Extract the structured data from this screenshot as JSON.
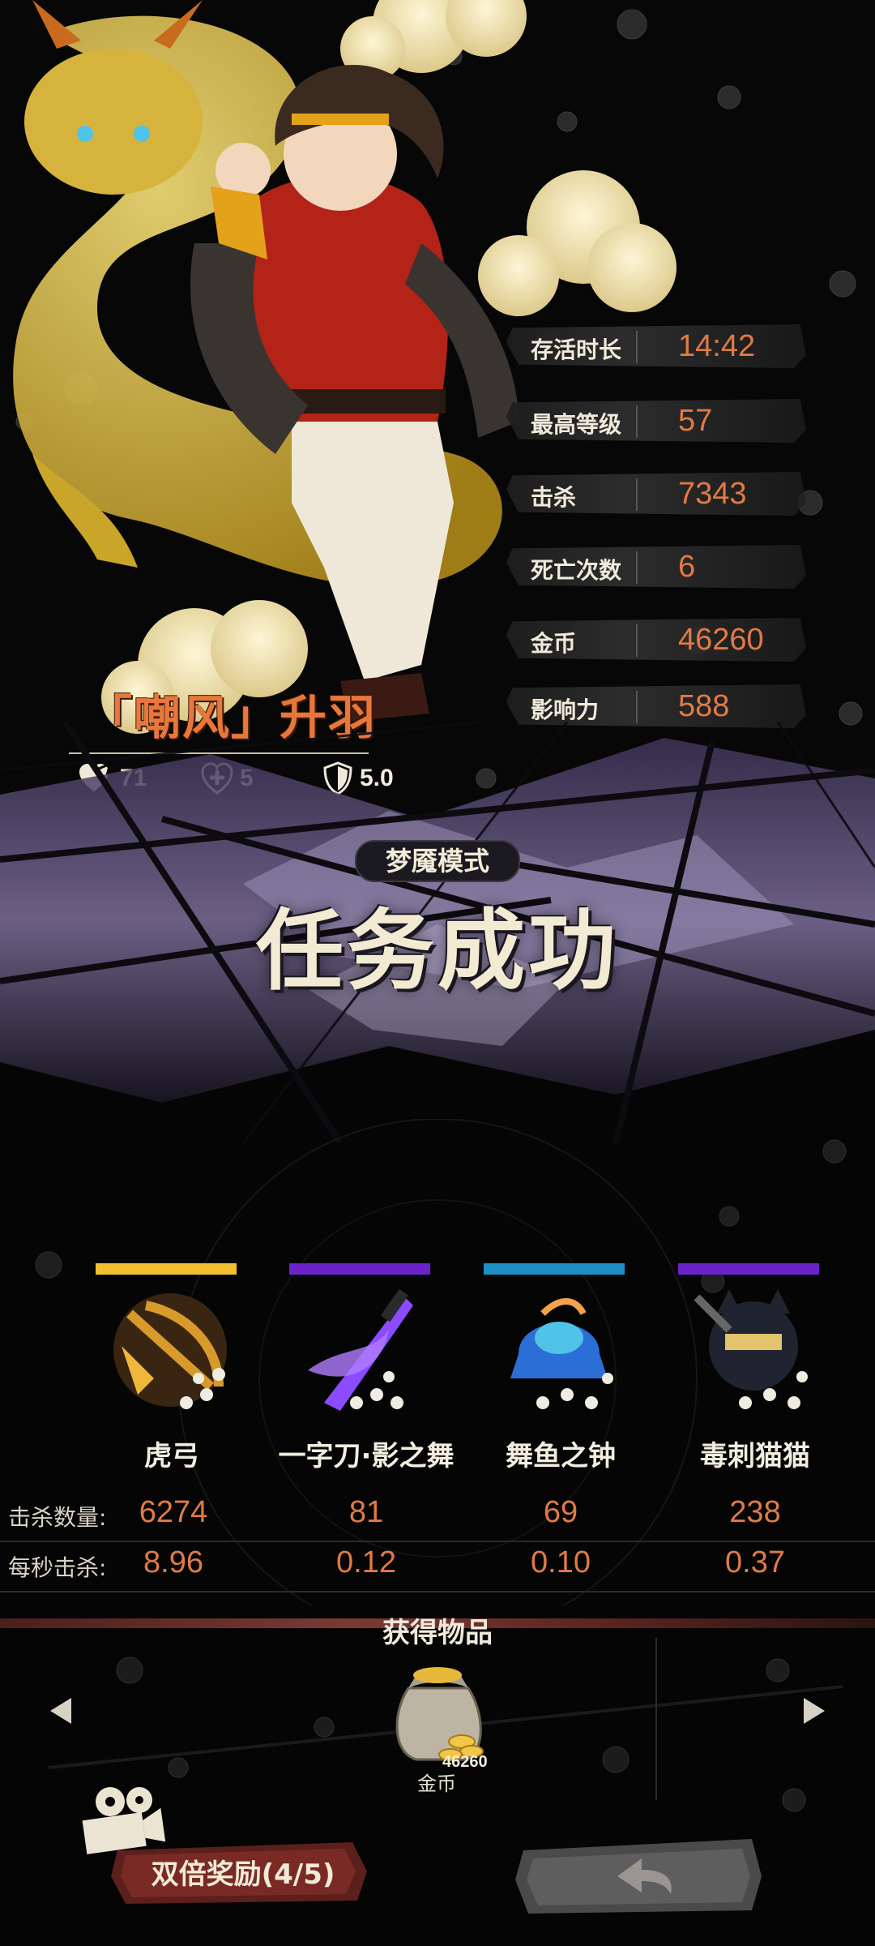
{
  "stats": [
    {
      "label": "存活时长",
      "value": "14:42"
    },
    {
      "label": "最高等级",
      "value": "57"
    },
    {
      "label": "击杀",
      "value": "7343"
    },
    {
      "label": "死亡次数",
      "value": "6"
    },
    {
      "label": "金币",
      "value": "46260"
    },
    {
      "label": "影响力",
      "value": "588"
    }
  ],
  "hero": {
    "name": "「嘲风」升羽",
    "attack": "71",
    "heal": "5",
    "defense": "5.0"
  },
  "mission": {
    "mode": "梦魇模式",
    "result": "任务成功"
  },
  "weapons": [
    {
      "name": "虎弓",
      "kills": "6274",
      "kps": "8.96",
      "bar_color": "#f2c02e",
      "icon": "tiger-bow-icon"
    },
    {
      "name": "一字刀·影之舞",
      "kills": "81",
      "kps": "0.12",
      "bar_color": "#6a23c9",
      "icon": "shadow-blade-icon"
    },
    {
      "name": "舞鱼之钟",
      "kills": "69",
      "kps": "0.10",
      "bar_color": "#1e8fc4",
      "icon": "fish-bell-icon"
    },
    {
      "name": "毒刺猫猫",
      "kills": "238",
      "kps": "0.37",
      "bar_color": "#6a23c9",
      "icon": "poison-cat-icon"
    }
  ],
  "labels": {
    "kills": "击杀数量:",
    "kps": "每秒击杀:"
  },
  "items": {
    "title": "获得物品",
    "list": [
      {
        "name": "金币",
        "count": "46260",
        "icon": "gold-bag-icon"
      }
    ]
  },
  "buttons": {
    "double": "双倍奖励(4/5)",
    "back_icon": "back-arrow-icon",
    "video_icon": "video-camera-icon"
  },
  "colors": {
    "value_orange": "#e07a46",
    "hero_name": "#e8773c"
  }
}
